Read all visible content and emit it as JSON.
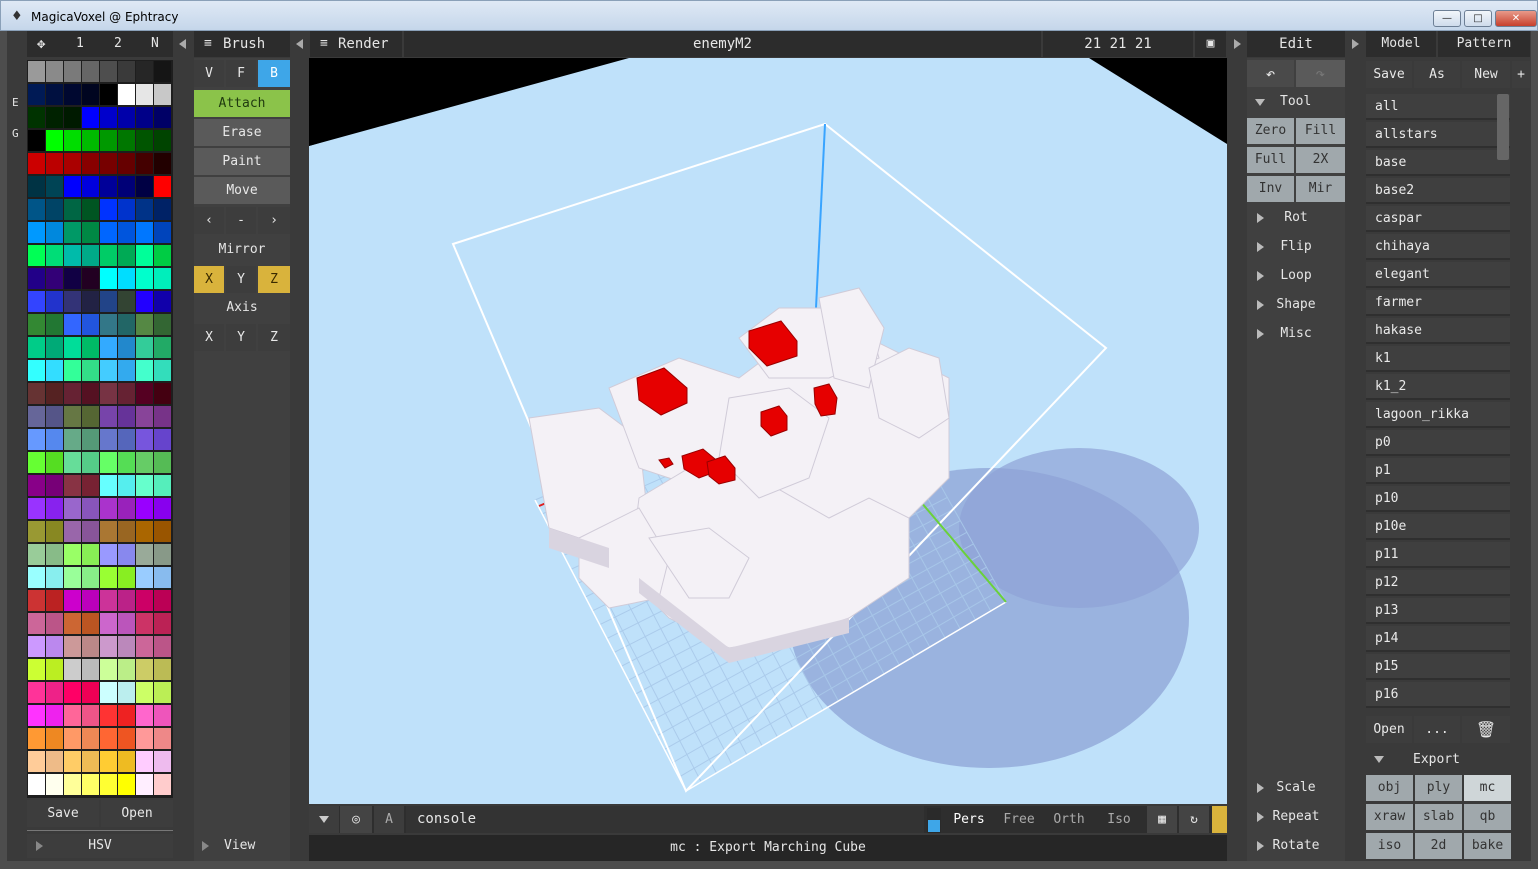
{
  "window": {
    "title": "MagicaVoxel @ Ephtracy",
    "logo_icon": "devil-icon"
  },
  "palette": {
    "tabs": [
      "1",
      "2",
      "N"
    ],
    "side_letters": [
      "E",
      "G"
    ],
    "save": "Save",
    "open": "Open",
    "hsv": "HSV",
    "rows": [
      [
        "#9a9a9a",
        "#8a8a8a",
        "#7a7a7a",
        "#666666",
        "#4e4e4e",
        "#3a3a3a",
        "#262626",
        "#151515"
      ],
      [
        "#001a55",
        "#001040",
        "#000830",
        "#000520",
        "#000000",
        "#ffffff",
        "#e6e6e6",
        "#c8c8c8"
      ],
      [
        "#003300",
        "#002200",
        "#001a00",
        "#0000ff",
        "#0000cc",
        "#0000aa",
        "#000088",
        "#000066"
      ],
      [
        "#000000",
        "#00ff00",
        "#00dd00",
        "#00bb00",
        "#009900",
        "#007700",
        "#005500",
        "#004400"
      ],
      [
        "#cc0000",
        "#bb0000",
        "#aa0000",
        "#880000",
        "#770000",
        "#660000",
        "#440000",
        "#220000"
      ],
      [
        "#003344",
        "#004455",
        "#0000ff",
        "#0000dd",
        "#000099",
        "#000077",
        "#000044",
        "#ff0000"
      ],
      [
        "#005588",
        "#004466",
        "#006644",
        "#005522",
        "#0033ff",
        "#0033cc",
        "#003388",
        "#002266"
      ],
      [
        "#0099ff",
        "#0088dd",
        "#009966",
        "#008844",
        "#0066ff",
        "#0055dd",
        "#0077ff",
        "#0044bb"
      ],
      [
        "#00ff55",
        "#00dd77",
        "#00bbaa",
        "#00aa88",
        "#00cc66",
        "#00aa55",
        "#00ff99",
        "#00cc44"
      ],
      [
        "#220088",
        "#330077",
        "#110044",
        "#220022",
        "#00ffff",
        "#00ddff",
        "#00ffcc",
        "#00eebb"
      ],
      [
        "#3344ff",
        "#2233cc",
        "#333377",
        "#222244",
        "#224488",
        "#334433",
        "#2200ff",
        "#1100aa"
      ],
      [
        "#338833",
        "#227733",
        "#3366ff",
        "#2255dd",
        "#337788",
        "#226666",
        "#558844",
        "#336633"
      ],
      [
        "#00cc88",
        "#00aa77",
        "#00dd99",
        "#00bb66",
        "#33aaff",
        "#2288cc",
        "#33cc99",
        "#22aa66"
      ],
      [
        "#33ffff",
        "#33ddff",
        "#33ff99",
        "#33dd88",
        "#44ccff",
        "#33aaee",
        "#44ffcc",
        "#33ddbb"
      ],
      [
        "#663333",
        "#552222",
        "#662233",
        "#551122",
        "#773344",
        "#662233",
        "#550022",
        "#440011"
      ],
      [
        "#666699",
        "#555588",
        "#667744",
        "#556633",
        "#7744aa",
        "#663399",
        "#884499",
        "#773388"
      ],
      [
        "#6699ff",
        "#5588ee",
        "#66aa88",
        "#559977",
        "#6677cc",
        "#5566bb",
        "#7755dd",
        "#6644cc"
      ],
      [
        "#66ff33",
        "#55dd22",
        "#66dd99",
        "#55cc88",
        "#66ff66",
        "#55dd55",
        "#66cc66",
        "#55bb55"
      ],
      [
        "#880088",
        "#770077",
        "#883344",
        "#772233",
        "#66ffff",
        "#55eeee",
        "#66ffcc",
        "#55eebb"
      ],
      [
        "#9933ff",
        "#8822ee",
        "#9966cc",
        "#8855bb",
        "#aa33cc",
        "#9922bb",
        "#9900ff",
        "#8800ee"
      ],
      [
        "#999933",
        "#888822",
        "#9966aa",
        "#885599",
        "#aa7733",
        "#996622",
        "#aa6600",
        "#995500"
      ],
      [
        "#99cc99",
        "#88bb88",
        "#99ff66",
        "#88ee55",
        "#9999ff",
        "#8888ee",
        "#99aa99",
        "#889988"
      ],
      [
        "#99ffff",
        "#88eeee",
        "#99ff99",
        "#88ee88",
        "#99ff33",
        "#88ee22",
        "#99ccff",
        "#88bbee"
      ],
      [
        "#cc3333",
        "#bb2222",
        "#cc00cc",
        "#bb00bb",
        "#cc3399",
        "#bb2288",
        "#cc0066",
        "#bb0055"
      ],
      [
        "#cc6699",
        "#bb5588",
        "#cc6633",
        "#bb5522",
        "#cc66cc",
        "#bb55bb",
        "#cc3366",
        "#bb2255"
      ],
      [
        "#cc99ff",
        "#bb88ee",
        "#cc9999",
        "#bb8888",
        "#cc99cc",
        "#bb88bb",
        "#cc6699",
        "#bb5588"
      ],
      [
        "#ccff33",
        "#bbee22",
        "#cccccc",
        "#bbbbbb",
        "#ccff99",
        "#bbee88",
        "#cccc66",
        "#bbbb55"
      ],
      [
        "#ff3399",
        "#ee2288",
        "#ff0066",
        "#ee0055",
        "#ccffff",
        "#bbeeee",
        "#ccff66",
        "#bbee55"
      ],
      [
        "#ff33ff",
        "#ee22ee",
        "#ff6699",
        "#ee5588",
        "#ff3333",
        "#ee2222",
        "#ff66cc",
        "#ee55bb"
      ],
      [
        "#ff9933",
        "#ee8822",
        "#ff9966",
        "#ee8855",
        "#ff6633",
        "#ee5522",
        "#ff9999",
        "#ee8888"
      ],
      [
        "#ffcc99",
        "#eebb88",
        "#ffcc66",
        "#eebb55",
        "#ffcc33",
        "#eebb22",
        "#ffccff",
        "#eebbee"
      ],
      [
        "#ffffff",
        "#ffffee",
        "#ffff99",
        "#ffff66",
        "#ffff33",
        "#ffff00",
        "#ffeeff",
        "#ffcccc"
      ]
    ]
  },
  "brush": {
    "header": "Brush",
    "modes": [
      "V",
      "F",
      "B"
    ],
    "actions": [
      "Attach",
      "Erase",
      "Paint",
      "Move"
    ],
    "small": [
      "‹",
      "-",
      "›"
    ],
    "mirror_label": "Mirror",
    "axis_label": "Axis",
    "axes": [
      "X",
      "Y",
      "Z"
    ],
    "view": "View"
  },
  "render": {
    "header": "Render",
    "model_name": "enemyM2",
    "dims": "21  21  21"
  },
  "bottom": {
    "console": "console",
    "a_label": "A",
    "views": [
      "Pers",
      "Free",
      "Orth",
      "Iso"
    ],
    "status": "mc : Export Marching Cube"
  },
  "edit": {
    "header": "Edit",
    "tool": "Tool",
    "tool_buttons": [
      [
        "Zero",
        "Fill"
      ],
      [
        "Full",
        "2X"
      ],
      [
        "Inv",
        "Mir"
      ]
    ],
    "groups": [
      "Rot",
      "Flip",
      "Loop",
      "Shape",
      "Misc"
    ],
    "bottom_groups": [
      "Scale",
      "Repeat",
      "Rotate"
    ]
  },
  "files": {
    "tabs": [
      "Model",
      "Pattern"
    ],
    "actions": [
      "Save",
      "As",
      "New",
      "+"
    ],
    "items": [
      "all",
      "allstars",
      "base",
      "base2",
      "caspar",
      "chihaya",
      "elegant",
      "farmer",
      "hakase",
      "k1",
      "k1_2",
      "lagoon_rikka",
      "p0",
      "p1",
      "p10",
      "p10e",
      "p11",
      "p12",
      "p13",
      "p14",
      "p15",
      "p16"
    ],
    "open": "Open",
    "more": "...",
    "export": "Export",
    "export_buttons": [
      [
        "obj",
        "ply",
        "mc"
      ],
      [
        "xraw",
        "slab",
        "qb"
      ],
      [
        "iso",
        "2d",
        "bake"
      ]
    ]
  },
  "colors": {
    "accent_green": "#8bc34a",
    "accent_yellow": "#d9b33c",
    "accent_blue": "#3ea6e8",
    "viewport_bg": "#bfe1fa"
  }
}
